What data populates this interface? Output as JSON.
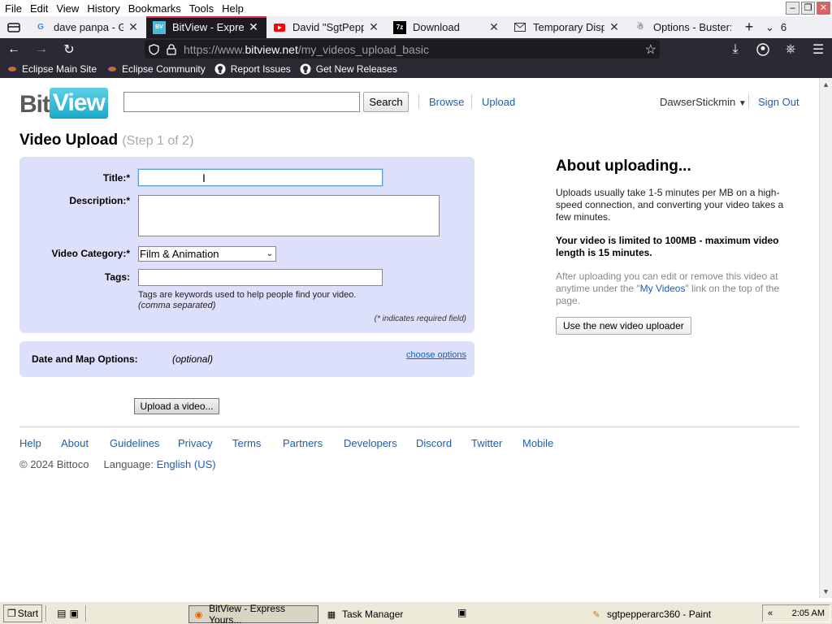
{
  "browser": {
    "menu": [
      "File",
      "Edit",
      "View",
      "History",
      "Bookmarks",
      "Tools",
      "Help"
    ],
    "tabs": [
      {
        "label": "dave panpa - Goo",
        "icon": "google-icon",
        "close": "✕"
      },
      {
        "label": "BitView - Express",
        "icon": "bitview-icon",
        "close": "✕"
      },
      {
        "label": "David \"SgtPepper",
        "icon": "youtube-icon",
        "close": "✕"
      },
      {
        "label": "Download",
        "icon": "7zip-icon",
        "close": "✕"
      },
      {
        "label": "Temporary Dispo",
        "icon": "mail-icon",
        "close": "✕"
      },
      {
        "label": "Options - Buster:",
        "icon": "puzzle-icon",
        "close": ""
      }
    ],
    "tab_count": "6",
    "url_prefix": "https://www.",
    "url_domain": "bitview.net",
    "url_path": "/my_videos_upload_basic",
    "bookmarks": [
      "Eclipse Main Site",
      "Eclipse Community",
      "Report Issues",
      "Get New Releases"
    ]
  },
  "site": {
    "logo_bit": "Bit",
    "logo_view": "View",
    "search_button": "Search",
    "nav": [
      "Browse",
      "Upload"
    ],
    "username": "DawserStickmin",
    "sign_out": "Sign Out"
  },
  "upload": {
    "title": "Video Upload",
    "step": "(Step 1 of 2)",
    "fields": {
      "title_label": "Title:*",
      "description_label": "Description:*",
      "category_label": "Video Category:*",
      "category_value": "Film & Animation",
      "tags_label": "Tags:",
      "tags_hint_1": "Tags are keywords used to help people find your video.",
      "tags_hint_2": "(comma separated)",
      "required_note": "(* indicates required field)"
    },
    "map": {
      "label": "Date and Map Options:",
      "optional": "(optional)",
      "choose": "choose options"
    },
    "upload_button": "Upload a video..."
  },
  "about": {
    "heading": "About uploading...",
    "p1": "Uploads usually take 1-5 minutes per MB on a high-speed connection, and converting your video takes a few minutes.",
    "p2": "Your video is limited to 100MB - maximum video length is 15 minutes.",
    "p3_before": "After uploading you can edit or remove this video at anytime under the \"",
    "p3_link": "My Videos",
    "p3_after": "\" link on the top of the page.",
    "button": "Use the new video uploader"
  },
  "footer": {
    "links": [
      "Help",
      "About",
      "Guidelines",
      "Privacy",
      "Terms",
      "Partners",
      "Developers",
      "Discord",
      "Twitter",
      "Mobile"
    ],
    "copyright": "© 2024 Bittoco",
    "language_label": "Language:",
    "language_value": "English (US)"
  },
  "taskbar": {
    "start": "Start",
    "items": [
      "BitView - Express Yours...",
      "Task Manager",
      "sgtpepperarc360 - Paint"
    ],
    "clock": "2:05 AM"
  },
  "colors": {
    "accent_tab": "#e22850",
    "form_bg": "#dde0fb",
    "link": "#1a5fb4"
  }
}
